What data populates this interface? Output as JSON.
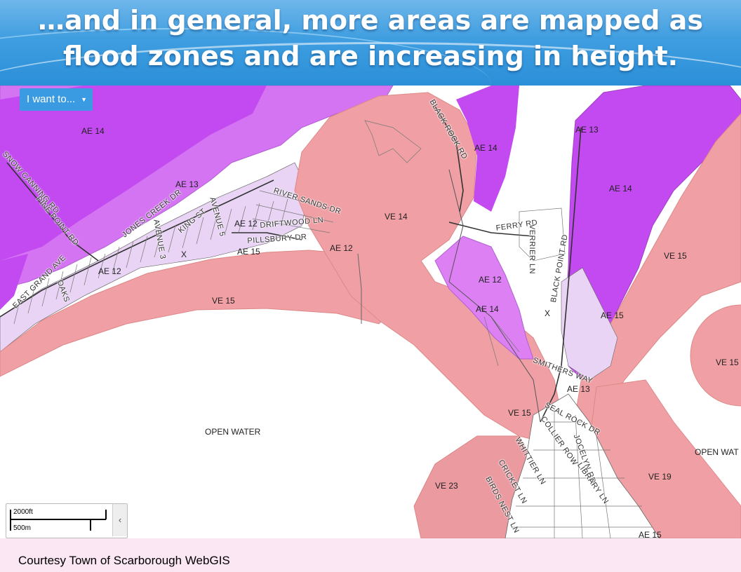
{
  "slide": {
    "title_line1": "…and in general, more areas are mapped as",
    "title_line2": "flood zones and are increasing in height.",
    "credit": "Courtesy Town of Scarborough WebGIS"
  },
  "map_ui": {
    "menu_button": "I want to...",
    "menu_caret": "▼",
    "scale_top": "2000ft",
    "scale_bottom": "500m",
    "collapse_glyph": "‹"
  },
  "colors": {
    "ve_zone": "#f0a0a4",
    "ae_zone_dark": "#c44cf2",
    "ae_zone_light": "#dc80f4",
    "open_water": "#ffffff",
    "title_blue": "#3f9ee0"
  },
  "zones": {
    "ae14_nw": "AE 14",
    "ae13_mid": "AE 13",
    "ae12_mid": "AE 12",
    "ae15_pills": "AE 15",
    "ae12_bay": "AE 12",
    "ae12_sw": "AE 12",
    "ae14_bay": "AE 14",
    "ae13_ne": "AE 13",
    "ae14_ne": "AE 14",
    "ae12_marsh": "AE 12",
    "ae14_marsh": "AE 14",
    "ae15_east": "AE 15",
    "ae13_smithers": "AE 13",
    "ae15_bottom": "AE 15",
    "ve14": "VE 14",
    "ve15_left": "VE 15",
    "ve15_right": "VE 15",
    "ve15_farright": "VE 15",
    "ve15_mid": "VE 15",
    "ve23": "VE 23",
    "ve19": "VE 19",
    "open_water_left": "OPEN WATER",
    "open_water_right": "OPEN WAT",
    "x_left": "X",
    "x_right": "X"
  },
  "roads": {
    "black_rock_rd": "BLACK ROCK RD",
    "old_county_rd": "SNOW CANNING RD",
    "pine_point_rd": "PINE POINT RD",
    "jones_creek_dr": "JONES CREEK DR",
    "river_sands_dr": "RIVER SANDS DR",
    "driftwood_ln": "DRIFTWOOD LN",
    "pillsbury_dr": "PILLSBURY DR",
    "king_st": "KING ST",
    "avenue_5": "AVENUE 5",
    "avenue_3": "AVENUE 3",
    "east_grand_ave": "EAST GRAND AVE",
    "oaks": "OAKS",
    "ferry_rd": "FERRY RD",
    "verrier_ln": "VERRIER LN",
    "black_point_rd": "BLACK POINT RD",
    "smithers_way": "SMITHERS WAY",
    "seal_rock_dr": "SEAL ROCK DR",
    "collier_row": "COLLIER ROW",
    "jocelyn_rd": "JOCELYN RD",
    "whittier_ln": "WHITTIER LN",
    "cricket_ln": "CRICKET LN",
    "birds_nest_ln": "BIRDS NEST LN",
    "library_ln": "LIBRARY LN"
  }
}
